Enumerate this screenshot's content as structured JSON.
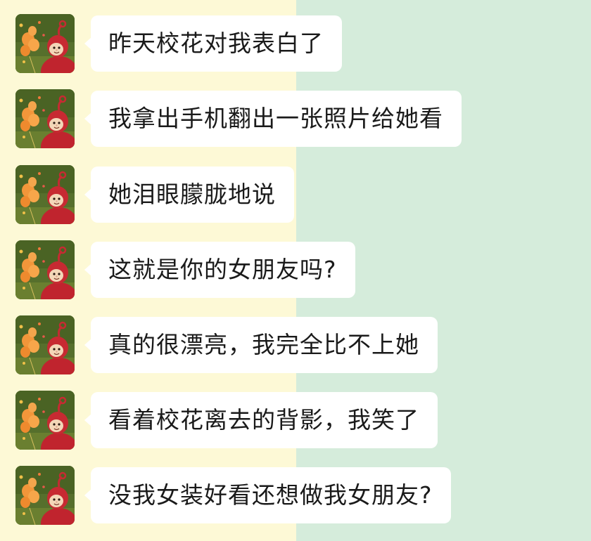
{
  "colors": {
    "background_left": "#fdf9d6",
    "background_right": "#d5ecdb",
    "bubble": "#ffffff",
    "text": "#1a1a1a"
  },
  "avatar": {
    "icon": "red-teletubby-avatar-icon"
  },
  "messages": [
    {
      "text": "昨天校花对我表白了"
    },
    {
      "text": "我拿出手机翻出一张照片给她看"
    },
    {
      "text": "她泪眼朦胧地说"
    },
    {
      "text": "这就是你的女朋友吗?"
    },
    {
      "text": "真的很漂亮，我完全比不上她"
    },
    {
      "text": "看着校花离去的背影，我笑了"
    },
    {
      "text": "没我女装好看还想做我女朋友?"
    }
  ]
}
